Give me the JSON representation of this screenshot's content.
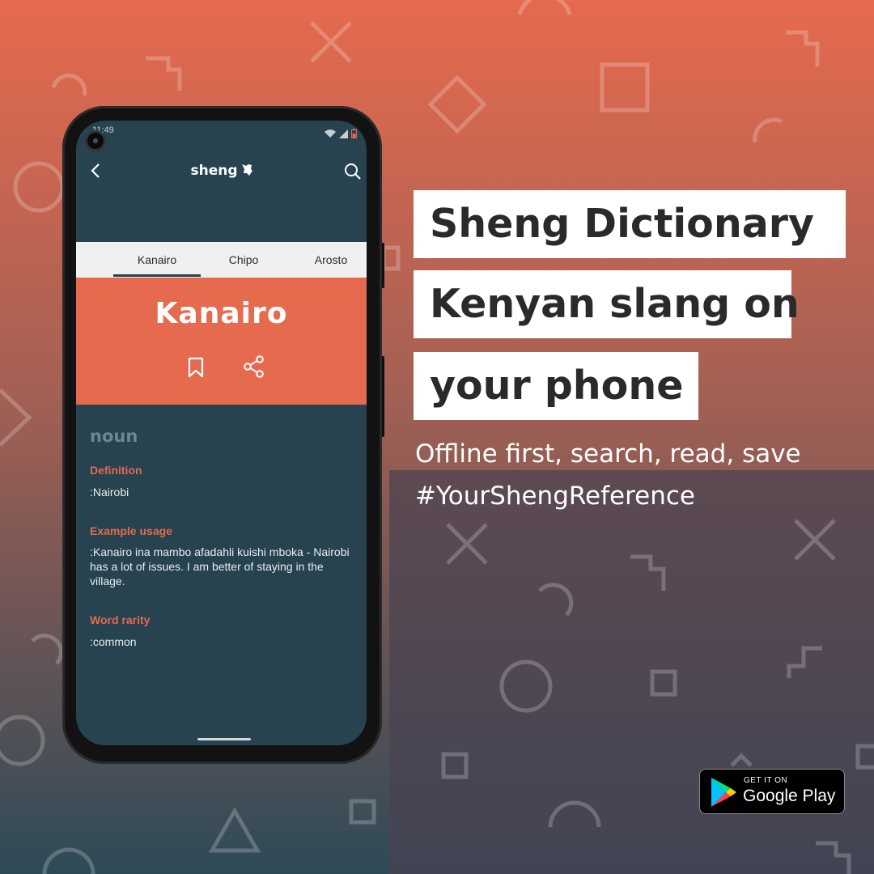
{
  "colors": {
    "accent": "#e56a4e",
    "app_background": "#26434f",
    "tab_bar": "#f0f0f0"
  },
  "status_bar": {
    "time": "11:49",
    "left_icons": [
      "screenshot-icon",
      "download-icon"
    ],
    "right_icons": [
      "wifi-icon",
      "signal-icon",
      "battery-icon"
    ]
  },
  "app_bar": {
    "logo_text": "sheng",
    "back_icon": "chevron-left-icon",
    "search_icon": "search-icon"
  },
  "tabs": [
    {
      "label": "Kanairo",
      "selected": true
    },
    {
      "label": "Chipo",
      "selected": false
    },
    {
      "label": "Arosto",
      "selected": false
    }
  ],
  "word_card": {
    "word": "Kanairo",
    "bookmark_icon": "bookmark-icon",
    "share_icon": "share-icon"
  },
  "entry": {
    "part_of_speech": "noun",
    "definition_title": "Definition",
    "definition": ":Nairobi",
    "example_title": "Example usage",
    "example": ":Kanairo ina mambo afadahli kuishi mboka - Nairobi has a lot of issues. I am better of staying in the village.",
    "rarity_title": "Word rarity",
    "rarity": ":common"
  },
  "promo": {
    "title_line1": "Sheng Dictionary",
    "title_line2": "Kenyan slang on",
    "title_line3": "your phone",
    "subtitle_line1": "Offline first, search, read, save",
    "subtitle_line2": "#YourShengReference"
  },
  "google_play_badge": {
    "small_text": "GET IT ON",
    "big_text": "Google Play"
  }
}
